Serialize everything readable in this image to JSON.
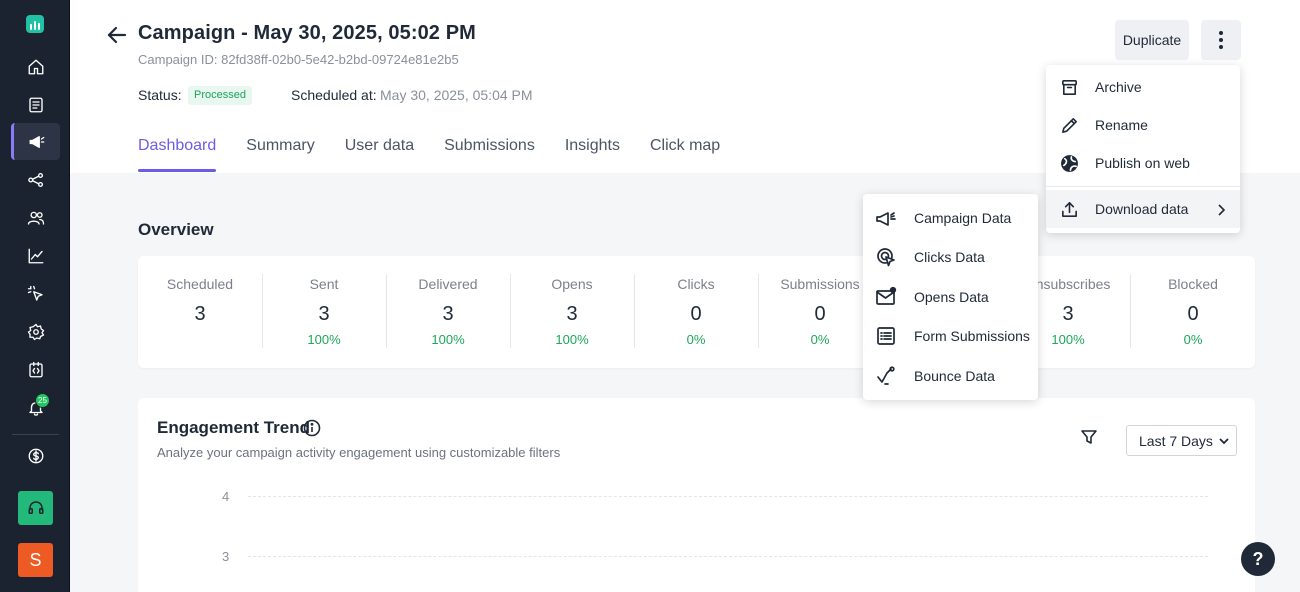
{
  "sidebar": {
    "items": [
      {
        "name": "home-icon"
      },
      {
        "name": "document-icon"
      },
      {
        "name": "megaphone-icon"
      },
      {
        "name": "share-icon"
      },
      {
        "name": "users-icon"
      },
      {
        "name": "chart-icon"
      },
      {
        "name": "pointer-icon"
      },
      {
        "name": "settings-icon"
      },
      {
        "name": "code-icon"
      },
      {
        "name": "bell-icon"
      }
    ],
    "notification_count": "25",
    "avatar_initial": "S",
    "accent_color": "#8b7cf6"
  },
  "header": {
    "title": "Campaign - May 30, 2025, 05:02 PM",
    "campaign_id": "Campaign ID: 82fd38ff-02b0-5e42-b2bd-09724e81e2b5",
    "status_label": "Status:",
    "status_value": "Processed",
    "scheduled_label": "Scheduled at:",
    "scheduled_value": "May 30, 2025, 05:04 PM",
    "duplicate_label": "Duplicate"
  },
  "tabs": [
    {
      "label": "Dashboard",
      "active": true
    },
    {
      "label": "Summary"
    },
    {
      "label": "User data"
    },
    {
      "label": "Submissions"
    },
    {
      "label": "Insights"
    },
    {
      "label": "Click map"
    }
  ],
  "overview": {
    "title": "Overview",
    "stats": [
      {
        "label": "Scheduled",
        "value": "3",
        "pct": ""
      },
      {
        "label": "Sent",
        "value": "3",
        "pct": "100%"
      },
      {
        "label": "Delivered",
        "value": "3",
        "pct": "100%"
      },
      {
        "label": "Opens",
        "value": "3",
        "pct": "100%"
      },
      {
        "label": "Clicks",
        "value": "0",
        "pct": "0%"
      },
      {
        "label": "Submissions",
        "value": "0",
        "pct": "0%"
      },
      {
        "label": "",
        "value": "",
        "pct": ""
      },
      {
        "label": "Unsubscribes",
        "value": "3",
        "pct": "100%"
      },
      {
        "label": "Blocked",
        "value": "0",
        "pct": "0%"
      }
    ]
  },
  "engagement": {
    "title": "Engagement Trend",
    "subtitle": "Analyze your campaign activity engagement using customizable filters",
    "range": "Last 7 Days",
    "y_ticks": [
      "4",
      "3"
    ]
  },
  "more_menu": {
    "items": [
      {
        "label": "Archive",
        "icon": "archive-icon"
      },
      {
        "label": "Rename",
        "icon": "pencil-icon"
      },
      {
        "label": "Publish on web",
        "icon": "globe-icon"
      },
      {
        "label": "Download data",
        "icon": "upload-icon"
      }
    ]
  },
  "download_menu": {
    "items": [
      {
        "label": "Campaign Data",
        "icon": "megaphone-icon"
      },
      {
        "label": "Clicks Data",
        "icon": "click-icon"
      },
      {
        "label": "Opens Data",
        "icon": "mail-icon"
      },
      {
        "label": "Form Submissions",
        "icon": "form-icon"
      },
      {
        "label": "Bounce Data",
        "icon": "bounce-icon"
      }
    ]
  },
  "help": {
    "label": "?"
  },
  "colors": {
    "primary": "#6c5ce7",
    "success": "#1ea55a",
    "sidebar_bg": "#1b2330"
  }
}
